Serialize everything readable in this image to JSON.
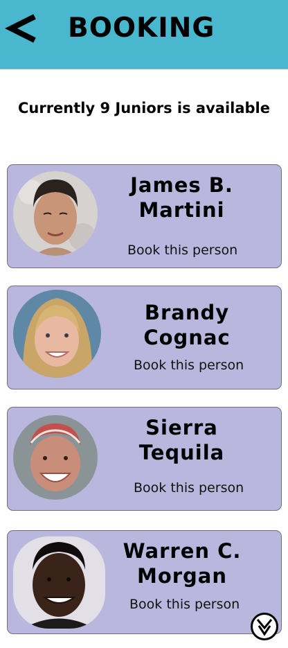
{
  "header": {
    "back_icon": "back-arrow-icon",
    "title": "BOOKING",
    "background_color": "#49b7cd"
  },
  "availability_text": "Currently 9 Juniors is available",
  "card_color": "#b9b7dd",
  "juniors": [
    {
      "name_line1": "James B.",
      "name_line2": "Martini",
      "book_label": "Book this person"
    },
    {
      "name_line1": "Brandy",
      "name_line2": "Cognac",
      "book_label": "Book this person"
    },
    {
      "name_line1": "Sierra",
      "name_line2": "Tequila",
      "book_label": "Book this person"
    },
    {
      "name_line1": "Warren C.",
      "name_line2": "Morgan",
      "book_label": "Book this person"
    }
  ],
  "scroll_button_icon": "double-chevron-down-icon"
}
